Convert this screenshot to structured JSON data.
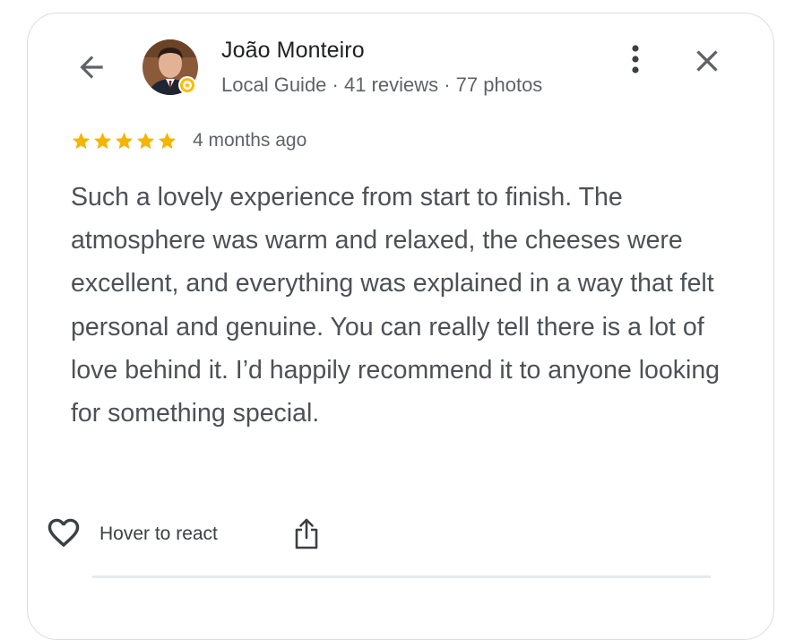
{
  "author": {
    "name": "João Monteiro",
    "meta": "Local Guide · 41 reviews · 77 photos"
  },
  "review": {
    "rating": 5,
    "rating_max": 5,
    "date": "4 months ago",
    "text": "Such a lovely experience from start to finish. The atmosphere was warm and relaxed, the cheeses were excellent, and everything was explained in a way that felt personal and genuine. You can really tell there is a lot of love behind it. I’d happily recommend it to anyone looking for something special."
  },
  "actions": {
    "react_label": "Hover to react"
  },
  "icons": {
    "back": "arrow-left-icon",
    "more": "more-vertical-icon",
    "close": "close-icon",
    "star": "star-icon",
    "heart": "heart-outline-icon",
    "share": "share-icon",
    "local_guide_badge": "local-guide-badge-icon"
  },
  "colors": {
    "star": "#f4b400",
    "text_primary": "#202124",
    "text_secondary": "#5f6368",
    "badge_ring": "#fbbc04"
  }
}
